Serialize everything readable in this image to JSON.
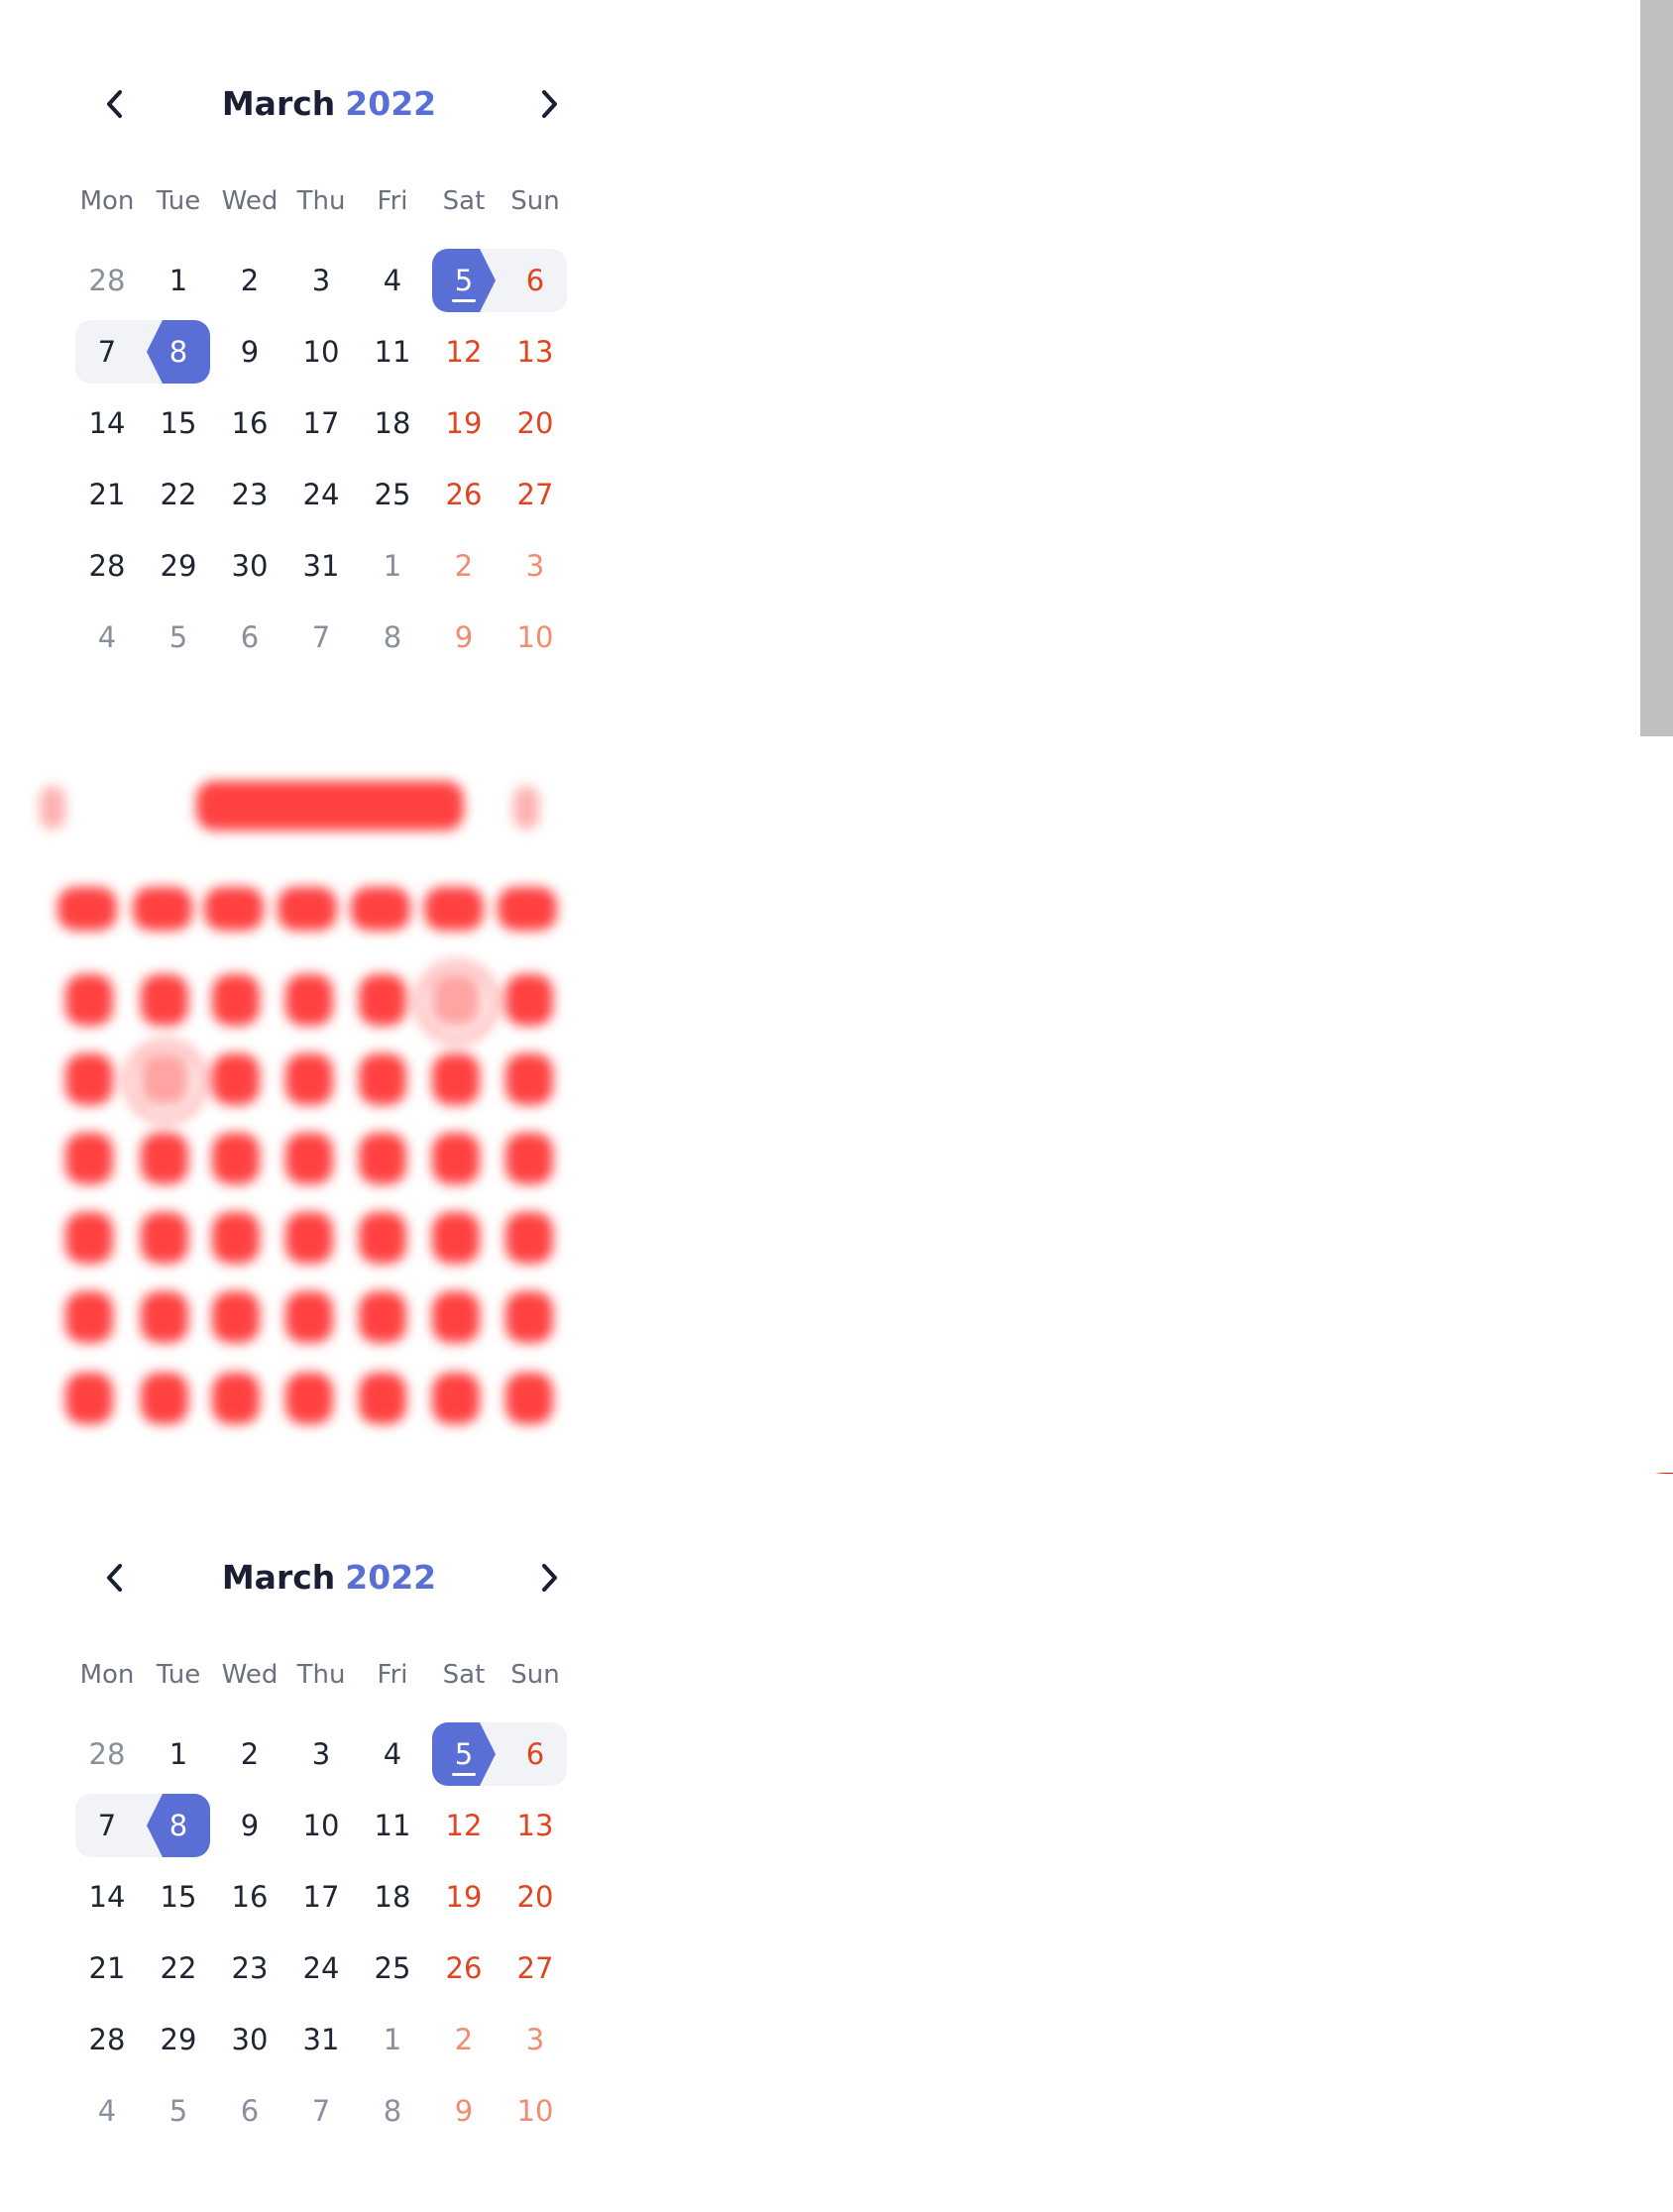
{
  "calendar_top": {
    "month": "March",
    "year": "2022",
    "weekdays": [
      "Mon",
      "Tue",
      "Wed",
      "Thu",
      "Fri",
      "Sat",
      "Sun"
    ],
    "rows": [
      [
        "28",
        "1",
        "2",
        "3",
        "4",
        "5",
        "6"
      ],
      [
        "7",
        "8",
        "9",
        "10",
        "11",
        "12",
        "13"
      ],
      [
        "14",
        "15",
        "16",
        "17",
        "18",
        "19",
        "20"
      ],
      [
        "21",
        "22",
        "23",
        "24",
        "25",
        "26",
        "27"
      ],
      [
        "28",
        "29",
        "30",
        "31",
        "1",
        "2",
        "3"
      ],
      [
        "4",
        "5",
        "6",
        "7",
        "8",
        "9",
        "10"
      ]
    ],
    "prev_icon": "chevron-left-icon",
    "next_icon": "chevron-right-icon"
  },
  "calendar_bottom": {
    "month": "March",
    "year": "2022",
    "weekdays": [
      "Mon",
      "Tue",
      "Wed",
      "Thu",
      "Fri",
      "Sat",
      "Sun"
    ],
    "rows": [
      [
        "28",
        "1",
        "2",
        "3",
        "4",
        "5",
        "6"
      ],
      [
        "7",
        "8",
        "9",
        "10",
        "11",
        "12",
        "13"
      ],
      [
        "14",
        "15",
        "16",
        "17",
        "18",
        "19",
        "20"
      ],
      [
        "21",
        "22",
        "23",
        "24",
        "25",
        "26",
        "27"
      ],
      [
        "28",
        "29",
        "30",
        "31",
        "1",
        "2",
        "3"
      ],
      [
        "4",
        "5",
        "6",
        "7",
        "8",
        "9",
        "10"
      ]
    ],
    "prev_icon": "chevron-left-icon",
    "next_icon": "chevron-right-icon"
  },
  "selection": {
    "range_start": "5",
    "range_end": "8",
    "today": "5"
  },
  "colors": {
    "accent": "#5a6fd6",
    "weekend": "#e0451f",
    "weekend_muted": "#f08c70",
    "text": "#1f2533",
    "muted": "#8a8f9c",
    "range_bg": "#f2f3f6",
    "overlay_red": "#ff2020"
  }
}
